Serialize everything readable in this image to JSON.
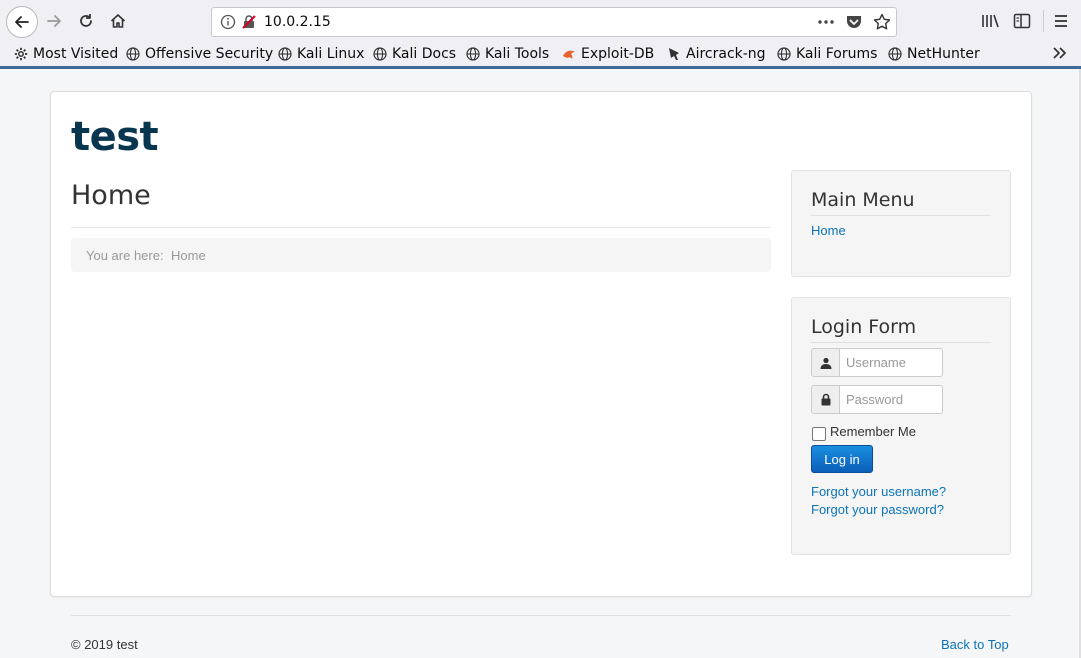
{
  "browser": {
    "url": "10.0.2.15",
    "bookmarks": [
      {
        "label": "Most Visited",
        "icon": "gear-icon"
      },
      {
        "label": "Offensive Security",
        "icon": "globe-icon"
      },
      {
        "label": "Kali Linux",
        "icon": "globe-icon"
      },
      {
        "label": "Kali Docs",
        "icon": "globe-icon"
      },
      {
        "label": "Kali Tools",
        "icon": "globe-icon"
      },
      {
        "label": "Exploit-DB",
        "icon": "exploitdb-icon"
      },
      {
        "label": "Aircrack-ng",
        "icon": "aircrack-icon"
      },
      {
        "label": "Kali Forums",
        "icon": "globe-icon"
      },
      {
        "label": "NetHunter",
        "icon": "globe-icon"
      }
    ]
  },
  "site": {
    "brand": "test",
    "page_title": "Home",
    "breadcrumb": {
      "prefix": "You are here:",
      "current": "Home"
    }
  },
  "main_menu": {
    "title": "Main Menu",
    "items": [
      {
        "label": "Home"
      }
    ]
  },
  "login_form": {
    "title": "Login Form",
    "username_placeholder": "Username",
    "password_placeholder": "Password",
    "remember_label": "Remember Me",
    "remember_checked": false,
    "submit_label": "Log in",
    "forgot_username": "Forgot your username?",
    "forgot_password": "Forgot your password?"
  },
  "footer": {
    "copyright": "© 2019 test",
    "back_to_top": "Back to Top"
  },
  "colors": {
    "brand": "#08364f",
    "link": "#0c73b8",
    "button": "#0c5fb8",
    "chrome_accent": "#3d6a99"
  }
}
